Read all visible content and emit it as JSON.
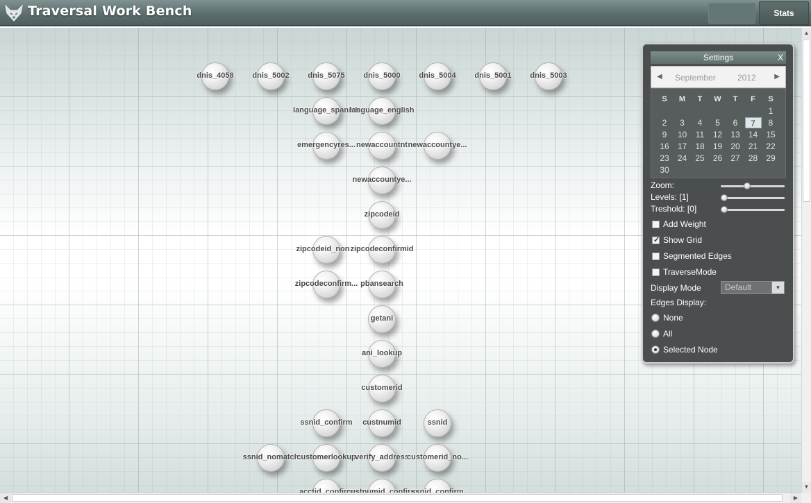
{
  "header": {
    "title": "Traversal Work Bench",
    "logo_icon": "fox-head-icon",
    "ghost_button_label": "",
    "stats_label": "Stats"
  },
  "graph": {
    "nodes": [
      {
        "label": "dnis_4058"
      },
      {
        "label": "dnis_5002"
      },
      {
        "label": "dnis_5075"
      },
      {
        "label": "dnis_5000"
      },
      {
        "label": "dnis_5004"
      },
      {
        "label": "dnis_5001"
      },
      {
        "label": "dnis_5003"
      },
      {
        "label": "language_spanish"
      },
      {
        "label": "language_english"
      },
      {
        "label": "emergencyres..."
      },
      {
        "label": "newaccountnt"
      },
      {
        "label": "newaccountye..."
      },
      {
        "label": "newaccountye..."
      },
      {
        "label": "zipcodeid"
      },
      {
        "label": "zipcodeid_non"
      },
      {
        "label": "zipcodeconfirmid"
      },
      {
        "label": "zipcodeconfirm..."
      },
      {
        "label": "pbansearch"
      },
      {
        "label": "getani"
      },
      {
        "label": "ani_lookup"
      },
      {
        "label": "customerid"
      },
      {
        "label": "ssnid_confirm"
      },
      {
        "label": "custnumid"
      },
      {
        "label": "ssnid"
      },
      {
        "label": "ssnid_nomatch"
      },
      {
        "label": "customerlookup"
      },
      {
        "label": "verify_address"
      },
      {
        "label": "customerid_no..."
      },
      {
        "label": "acctid_confirm"
      },
      {
        "label": "custnumid_confirm"
      },
      {
        "label": "ssnid_confirm"
      }
    ]
  },
  "settings": {
    "title": "Settings",
    "close": "X",
    "calendar": {
      "prev": "◀",
      "next": "▶",
      "month": "September",
      "year": "2012",
      "dow": [
        "S",
        "M",
        "T",
        "W",
        "T",
        "F",
        "S"
      ],
      "days": [
        "1",
        "2",
        "3",
        "4",
        "5",
        "6",
        "7",
        "8",
        "9",
        "10",
        "11",
        "12",
        "13",
        "14",
        "15",
        "16",
        "17",
        "18",
        "19",
        "20",
        "21",
        "22",
        "23",
        "24",
        "25",
        "26",
        "27",
        "28",
        "29",
        "30"
      ],
      "first_weekday": 6,
      "selected_day": 7
    },
    "zoom_label": "Zoom:",
    "zoom_value": 0.4,
    "levels_label": "Levels: [1]",
    "levels_value": 0,
    "threshold_label": "Treshold: [0]",
    "threshold_value": 0,
    "add_weight": {
      "label": "Add Weight",
      "checked": false
    },
    "show_grid": {
      "label": "Show Grid",
      "checked": true
    },
    "segmented_edges": {
      "label": "Segmented Edges",
      "checked": false
    },
    "traverse_mode": {
      "label": "TraverseMode",
      "checked": false
    },
    "display_mode_label": "Display Mode",
    "display_mode_value": "Default",
    "edges_display_label": "Edges Display:",
    "edges_none": "None",
    "edges_all": "All",
    "edges_selected": "Selected Node",
    "edges_selected_value": "Selected Node"
  },
  "colors": {
    "header": "#5c6f6e",
    "panel": "#4a4e4e",
    "accent": "#7c8d8c"
  }
}
